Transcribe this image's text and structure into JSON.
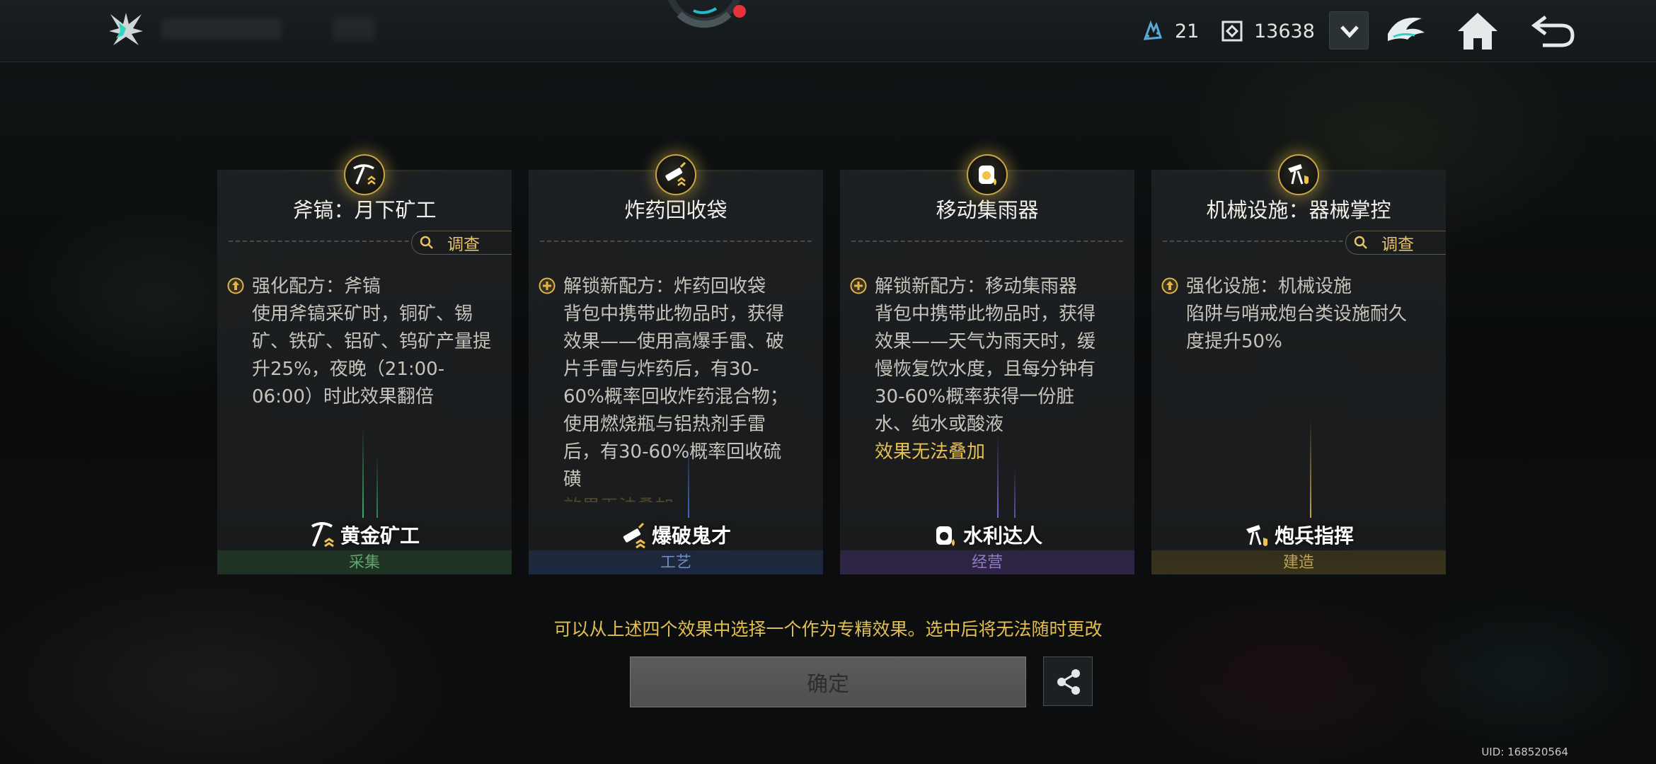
{
  "topbar": {
    "logo_icon": "lightning-star-logo-icon",
    "resources": [
      {
        "icon": "ore-crystal-icon",
        "value": "21"
      },
      {
        "icon": "coin-icon",
        "value": "13638"
      }
    ],
    "dropdown_icon": "chevron-down-icon",
    "clan_icon": "clan-emblem-icon",
    "home_icon": "home-icon",
    "back_icon": "back-arrow-icon"
  },
  "cards": [
    {
      "title": "斧镐：月下矿工",
      "medal_icon": "pickaxe-icon",
      "has_investigate": true,
      "investigate_label": "调查",
      "effect_icon": "upgrade-arrow-icon",
      "effect_lines": [
        "强化配方：斧镐",
        "使用斧镐采矿时，铜矿、锡",
        "矿、铁矿、铝矿、钨矿产量提",
        "升25%，夜晚（21:00-",
        "06:00）时此效果翻倍"
      ],
      "warning": "",
      "specialist": "黄金矿工",
      "category": "采集"
    },
    {
      "title": "炸药回收袋",
      "medal_icon": "dynamite-icon",
      "has_investigate": false,
      "investigate_label": "",
      "effect_icon": "plus-circle-icon",
      "effect_lines": [
        "解锁新配方：炸药回收袋",
        "背包中携带此物品时，获得",
        "效果——使用高爆手雷、破",
        "片手雷与炸药后，有30-",
        "60%概率回收炸药混合物；",
        "使用燃烧瓶与铝热剂手雷",
        "后，有30-60%概率回收硫",
        "磺"
      ],
      "warning": "效果无法叠加",
      "specialist": "爆破鬼才",
      "category": "工艺"
    },
    {
      "title": "移动集雨器",
      "medal_icon": "rain-collector-icon",
      "has_investigate": false,
      "investigate_label": "",
      "effect_icon": "plus-circle-icon",
      "effect_lines": [
        "解锁新配方：移动集雨器",
        "背包中携带此物品时，获得",
        "效果——天气为雨天时，缓",
        "慢恢复饮水度，且每分钟有",
        "30-60%概率获得一份脏",
        "水、纯水或酸液"
      ],
      "warning": "效果无法叠加",
      "specialist": "水利达人",
      "category": "经营"
    },
    {
      "title": "机械设施：器械掌控",
      "medal_icon": "turret-icon",
      "has_investigate": true,
      "investigate_label": "调查",
      "effect_icon": "upgrade-arrow-icon",
      "effect_lines": [
        "强化设施：机械设施",
        "陷阱与哨戒炮台类设施耐久",
        "度提升50%"
      ],
      "warning": "",
      "specialist": "炮兵指挥",
      "category": "建造"
    }
  ],
  "hint": "可以从上述四个效果中选择一个作为专精效果。选中后将无法随时更改",
  "confirm_label": "确定",
  "share_icon": "share-icon",
  "uid": "UID: 168520564",
  "colors": {
    "accent_gold": "#e3bf53",
    "gather": "#5fa56c",
    "craft": "#6f8cc5",
    "manage": "#8f7bc8",
    "build": "#bda258"
  }
}
